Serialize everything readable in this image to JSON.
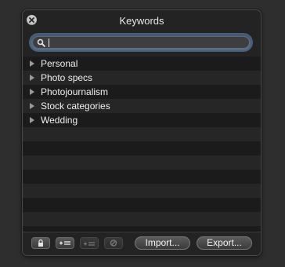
{
  "window": {
    "title": "Keywords"
  },
  "search": {
    "value": "",
    "placeholder": ""
  },
  "keywords": [
    {
      "label": "Personal",
      "expanded": false
    },
    {
      "label": "Photo specs",
      "expanded": false
    },
    {
      "label": "Photojournalism",
      "expanded": false
    },
    {
      "label": "Stock categories",
      "expanded": false
    },
    {
      "label": "Wedding",
      "expanded": false
    }
  ],
  "toolbar": {
    "lock_icon": "lock-icon",
    "add_keyword_icon": "add-keyword-icon",
    "add_subkeyword_icon": "add-subkeyword-icon",
    "delete_icon": "delete-icon",
    "import_label": "Import...",
    "export_label": "Export..."
  },
  "colors": {
    "background": "#2e2e2e",
    "panel": "#232323",
    "row_odd": "#262626",
    "row_even": "#1b1b1b",
    "search_focus_ring": "#5a6d84",
    "text": "#efefef"
  }
}
